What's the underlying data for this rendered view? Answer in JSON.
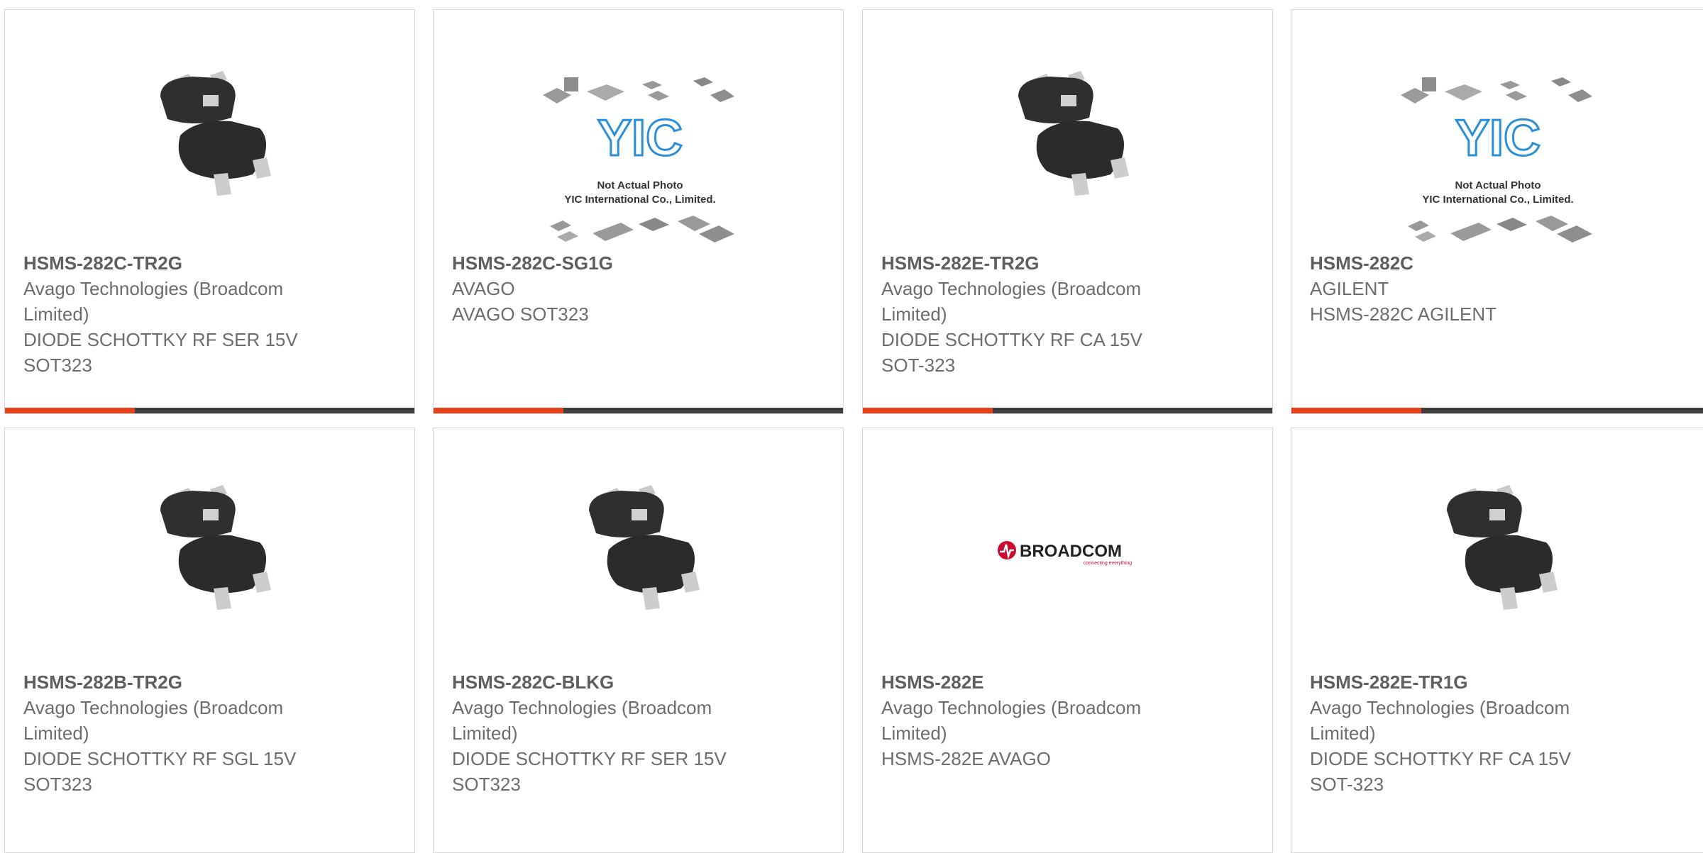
{
  "products": [
    {
      "part_number": "HSMS-282C-TR2G",
      "manufacturer": [
        "Avago Technologies (Broadcom",
        "Limited)"
      ],
      "description": [
        "DIODE SCHOTTKY RF SER 15V",
        "SOT323"
      ],
      "image": "sot323-package-photo"
    },
    {
      "part_number": "HSMS-282C-SG1G",
      "manufacturer": [
        "AVAGO"
      ],
      "description": [
        "AVAGO SOT323"
      ],
      "image": "yic-placeholder",
      "placeholder_caption": [
        "Not Actual Photo",
        "YIC International Co., Limited."
      ],
      "placeholder_logo": "YIC"
    },
    {
      "part_number": "HSMS-282E-TR2G",
      "manufacturer": [
        "Avago Technologies (Broadcom",
        "Limited)"
      ],
      "description": [
        "DIODE SCHOTTKY RF CA 15V",
        "SOT-323"
      ],
      "image": "sot323-package-photo"
    },
    {
      "part_number": "HSMS-282C",
      "manufacturer": [
        "AGILENT"
      ],
      "description": [
        "HSMS-282C AGILENT"
      ],
      "image": "yic-placeholder",
      "placeholder_caption": [
        "Not Actual Photo",
        "YIC International Co., Limited."
      ],
      "placeholder_logo": "YIC"
    },
    {
      "part_number": "HSMS-282B-TR2G",
      "manufacturer": [
        "Avago Technologies (Broadcom",
        "Limited)"
      ],
      "description": [
        "DIODE SCHOTTKY RF SGL 15V",
        "SOT323"
      ],
      "image": "sot323-package-photo"
    },
    {
      "part_number": "HSMS-282C-BLKG",
      "manufacturer": [
        "Avago Technologies (Broadcom",
        "Limited)"
      ],
      "description": [
        "DIODE SCHOTTKY RF SER 15V",
        "SOT323"
      ],
      "image": "sot323-package-photo"
    },
    {
      "part_number": "HSMS-282E",
      "manufacturer": [
        "Avago Technologies (Broadcom",
        "Limited)"
      ],
      "description": [
        "HSMS-282E AVAGO"
      ],
      "image": "broadcom-logo",
      "logo_text": "BROADCOM",
      "logo_tagline": "connecting everything"
    },
    {
      "part_number": "HSMS-282E-TR1G",
      "manufacturer": [
        "Avago Technologies (Broadcom",
        "Limited)"
      ],
      "description": [
        "DIODE SCHOTTKY RF CA 15V",
        "SOT-323"
      ],
      "image": "sot323-package-photo"
    }
  ],
  "colors": {
    "accent": "#e8411a",
    "bar": "#3f3f3f",
    "border": "#d6d6d6",
    "text": "#6d6d6d",
    "placeholder_logo": "#2a8fd6",
    "broadcom_red": "#cc092f"
  }
}
